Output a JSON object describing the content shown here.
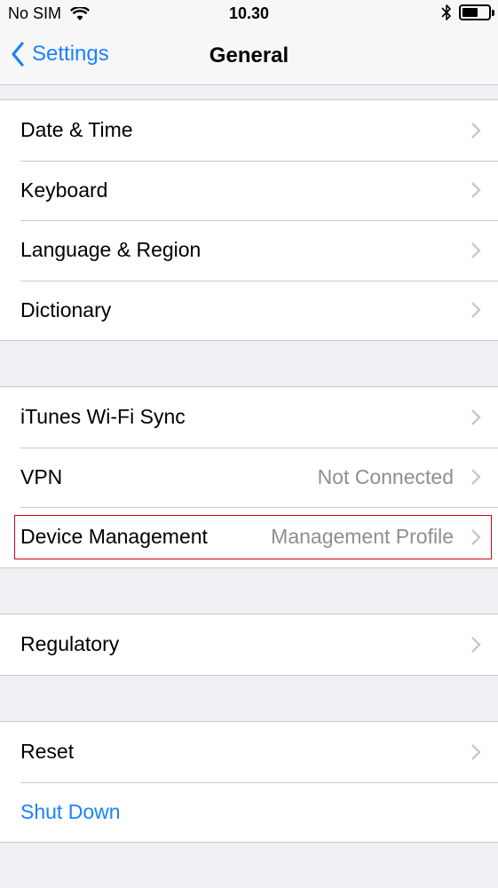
{
  "status_bar": {
    "carrier": "No SIM",
    "time": "10.30",
    "battery_level": 0.6
  },
  "nav": {
    "back_label": "Settings",
    "title": "General"
  },
  "groups": [
    {
      "rows": [
        {
          "label": "Date & Time"
        },
        {
          "label": "Keyboard"
        },
        {
          "label": "Language & Region"
        },
        {
          "label": "Dictionary"
        }
      ]
    },
    {
      "rows": [
        {
          "label": "iTunes Wi-Fi Sync"
        },
        {
          "label": "VPN",
          "value": "Not Connected"
        },
        {
          "label": "Device Management",
          "value": "Management Profile",
          "highlighted": true
        }
      ]
    },
    {
      "rows": [
        {
          "label": "Regulatory"
        }
      ]
    },
    {
      "rows": [
        {
          "label": "Reset"
        },
        {
          "label": "Shut Down",
          "action": true
        }
      ]
    }
  ],
  "colors": {
    "accent": "#1a82fb",
    "highlight": "#d0021b",
    "background": "#efeff4",
    "secondary_text": "#8e8e93"
  }
}
